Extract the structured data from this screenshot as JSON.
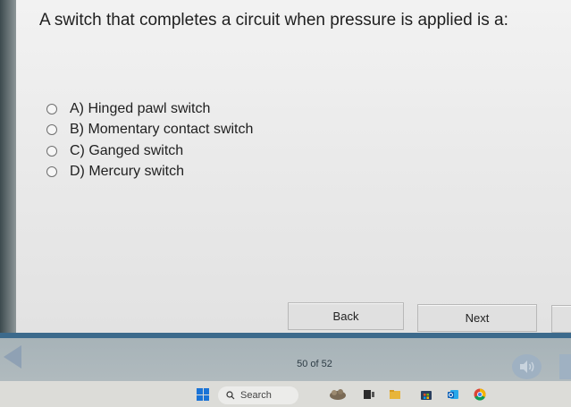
{
  "question": {
    "text": "A switch that completes a circuit when pressure is applied is a:"
  },
  "options": [
    {
      "label": "A) Hinged pawl switch",
      "selected": false
    },
    {
      "label": "B) Momentary contact switch",
      "selected": false
    },
    {
      "label": "C) Ganged switch",
      "selected": false
    },
    {
      "label": "D) Mercury switch",
      "selected": false
    }
  ],
  "buttons": {
    "back_label": "Back",
    "next_label": "Next"
  },
  "navigation": {
    "page_counter": "50 of 52",
    "back_arrow_icon": "left-arrow-icon",
    "audio_icon": "speaker-icon"
  },
  "taskbar": {
    "search_label": "Search",
    "icons": [
      "windows-start-icon",
      "search-icon",
      "weather-widget-icon",
      "task-view-icon",
      "file-explorer-icon",
      "store-icon",
      "outlook-icon",
      "chrome-icon"
    ]
  },
  "colors": {
    "nav_accent": "#3c6a8c",
    "nav_bar": "#b0babe",
    "windows_blue": "#1a73d6"
  }
}
